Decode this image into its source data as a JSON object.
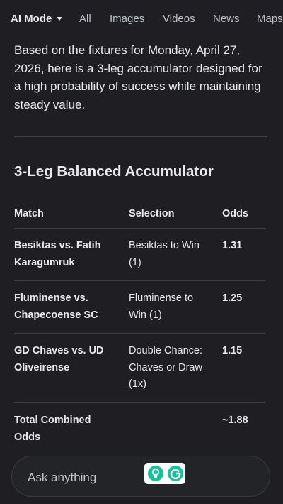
{
  "tabs": [
    {
      "label": "AI Mode",
      "active": true
    },
    {
      "label": "All"
    },
    {
      "label": "Images"
    },
    {
      "label": "Videos"
    },
    {
      "label": "News"
    },
    {
      "label": "Maps"
    }
  ],
  "intro": "Based on the fixtures for Monday, April 27, 2026, here is a 3-leg accumulator designed for a high probability of success while maintaining steady value.",
  "heading": "3-Leg Balanced Accumulator",
  "table": {
    "headers": {
      "match": "Match",
      "selection": "Selection",
      "odds": "Odds"
    },
    "rows": [
      {
        "match": "Besiktas vs. Fatih Karagumruk",
        "selection": "Besiktas to Win (1)",
        "odds": "1.31"
      },
      {
        "match": "Fluminense vs. Chapecoense SC",
        "selection": "Fluminense to Win (1)",
        "odds": "1.25"
      },
      {
        "match": "GD Chaves vs. UD Oliveirense",
        "selection": "Double Chance: Chaves or Draw (1x)",
        "odds": "1.15"
      }
    ],
    "total": {
      "label": "Total Combined Odds",
      "odds": "~1.88"
    }
  },
  "ask": {
    "placeholder": "Ask anything"
  },
  "icons": {
    "extension_left": "lightbulb-icon",
    "extension_right": "grammarly-icon"
  },
  "colors": {
    "background": "#1f1f23",
    "extension_green": "#15c39a"
  }
}
